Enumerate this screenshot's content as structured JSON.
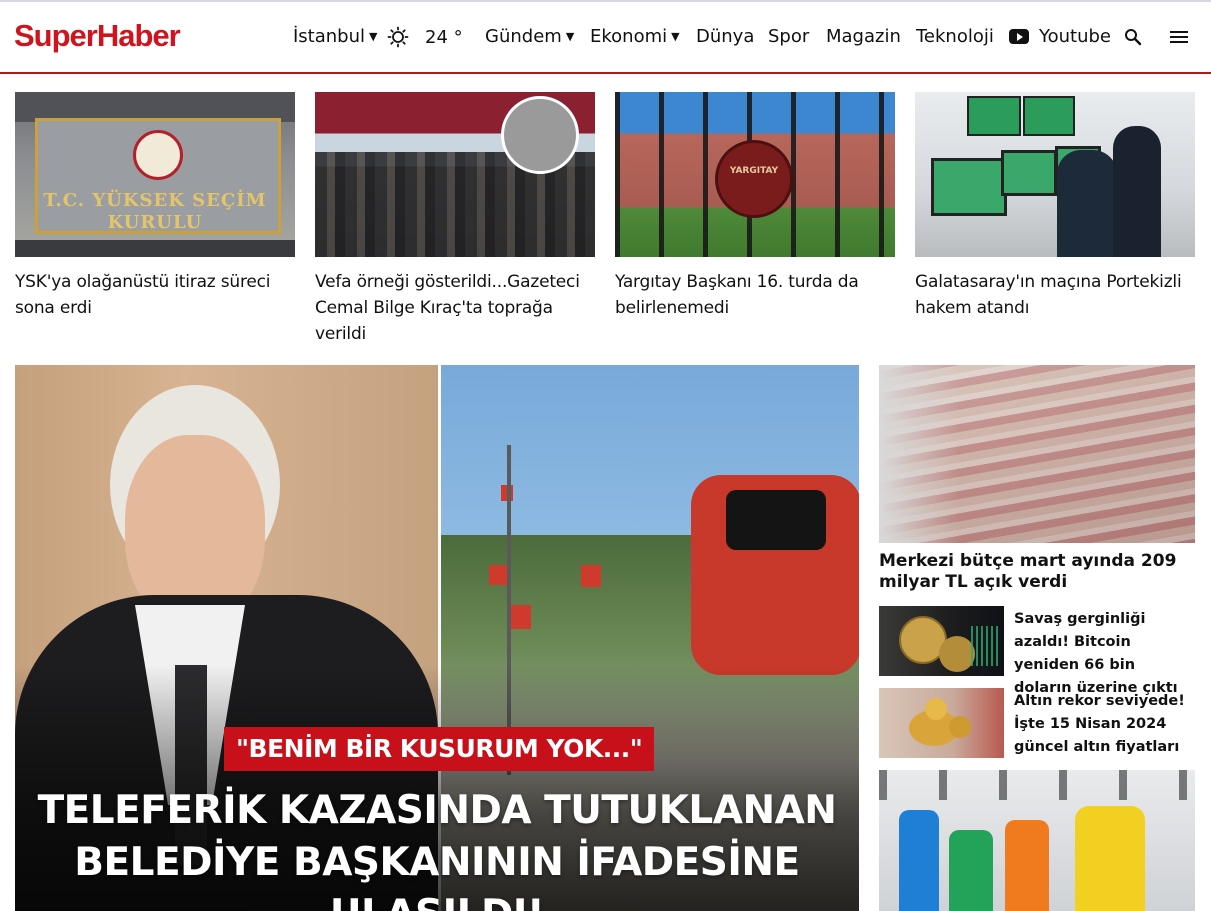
{
  "brand": {
    "logo": "SuperHaber"
  },
  "header": {
    "city": "İstanbul",
    "temperature": "24 °",
    "nav": [
      "Gündem",
      "Ekonomi",
      "Dünya",
      "Spor",
      "Magazin",
      "Teknoloji"
    ],
    "youtube": "Youtube"
  },
  "top_news": [
    {
      "title": "YSK'ya olağanüstü itiraz süreci sona erdi"
    },
    {
      "title": "Vefa örneği gösterildi...Gazeteci Cemal Bilge Kıraç'ta toprağa verildi"
    },
    {
      "title": "Yargıtay Başkanı 16. turda da belirlenemedi"
    },
    {
      "title": "Galatasaray'ın maçına Portekizli hakem atandı"
    }
  ],
  "hero": {
    "tag": "\"BENİM BİR KUSURUM YOK...\"",
    "title": "TELEFERİK KAZASINDA TUTUKLANAN BELEDİYE BAŞKANININ İFADESİNE ULAŞILDI!"
  },
  "sidebar": {
    "main_title": "Merkezi bütçe mart ayında 209 milyar TL açık verdi",
    "items": [
      {
        "title": "Savaş gerginliği azaldı! Bitcoin yeniden 66 bin doların üzerine çıktı"
      },
      {
        "title": "Altın rekor seviyede! İşte 15 Nisan 2024 güncel altın fiyatları"
      }
    ]
  },
  "images": {
    "ysk_sign_text": "T.C. YÜKSEK SEÇİM KURULU",
    "yargitay_seal_text": "YARGITAY"
  },
  "colors": {
    "brand_red": "#d0141f",
    "header_border": "#b8161f",
    "tag_red": "#c8101a"
  }
}
